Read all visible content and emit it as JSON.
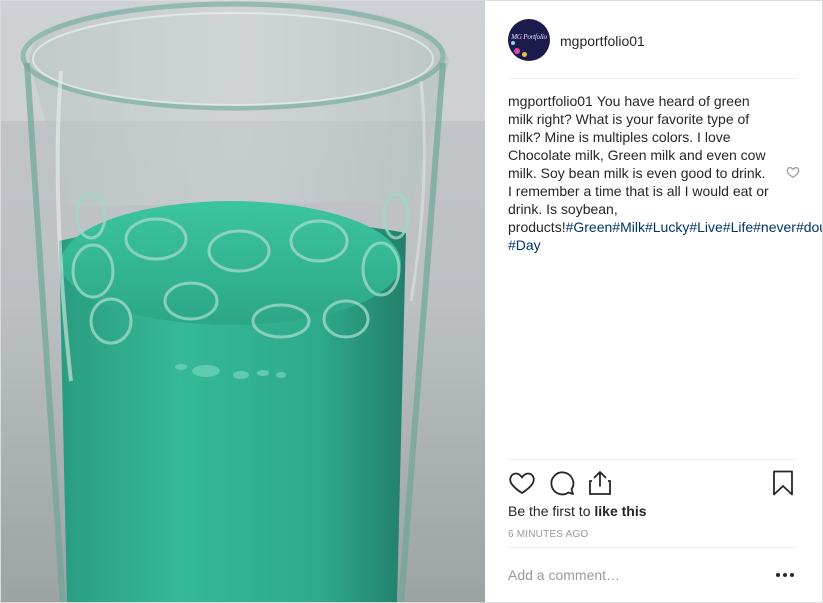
{
  "post": {
    "username": "mgportfolio01",
    "avatar_text": "MG Portfolio",
    "caption_user": "mgportfolio01",
    "caption_body": "You have heard of green milk right? What is your favorite type of milk? Mine is multiples colors. I love Chocolate milk, Green milk and even cow milk. Soy bean milk is even good to drink. I remember a time that is all I would eat or drink. Is soybean, products!",
    "caption_tags": "#Green#Milk#Lucky#Live#Life#never#doubt#Happy#St.#Patrick's #Day",
    "likes_prefix": "Be the first to ",
    "likes_cta": "like this",
    "timestamp": "6 MINUTES AGO",
    "comment_placeholder": "Add a comment…",
    "more_label": "•••"
  },
  "icons": {
    "like": "heart-icon",
    "comment": "comment-icon",
    "share": "share-icon",
    "save": "bookmark-icon",
    "caption_like": "heart-icon",
    "more": "more-options-icon"
  },
  "colors": {
    "milk": "#2fb392",
    "link": "#003569",
    "muted": "#999999",
    "text": "#262626",
    "avatar_bg": "#1d1a4c"
  }
}
